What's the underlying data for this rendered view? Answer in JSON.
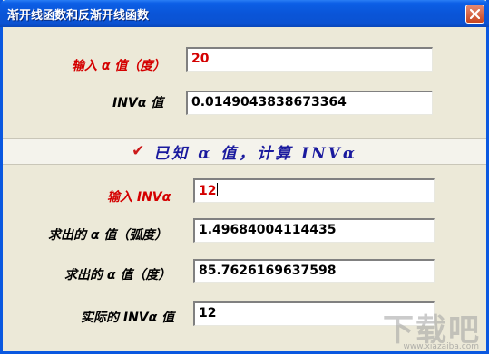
{
  "window": {
    "title": "渐开线函数和反渐开线函数"
  },
  "top_section": {
    "input_alpha_label": "输入 α 值（度）",
    "input_alpha_value": "20",
    "inv_label": "INVα 值",
    "inv_value": "0.0149043838673364"
  },
  "section_bar": {
    "check_icon": "✔",
    "text": "已知  α 值，计算 INVα"
  },
  "bottom_section": {
    "input_inv_label": "输入 INVα",
    "input_inv_value": "12",
    "alpha_rad_label": "求出的 α 值（弧度）",
    "alpha_rad_value": "1.49684004114435",
    "alpha_deg_label": "求出的 α 值（度）",
    "alpha_deg_value": "85.7626169637598",
    "actual_inv_label": "实际的 INVα 值",
    "actual_inv_value": "12"
  },
  "watermark": {
    "text": "下载吧",
    "url": "www.xiazaiba.com"
  },
  "colors": {
    "titlebar": "#0a55d8",
    "window_bg": "#ece9d8",
    "label_red": "#d40000",
    "section_text": "#1a1a9e"
  }
}
